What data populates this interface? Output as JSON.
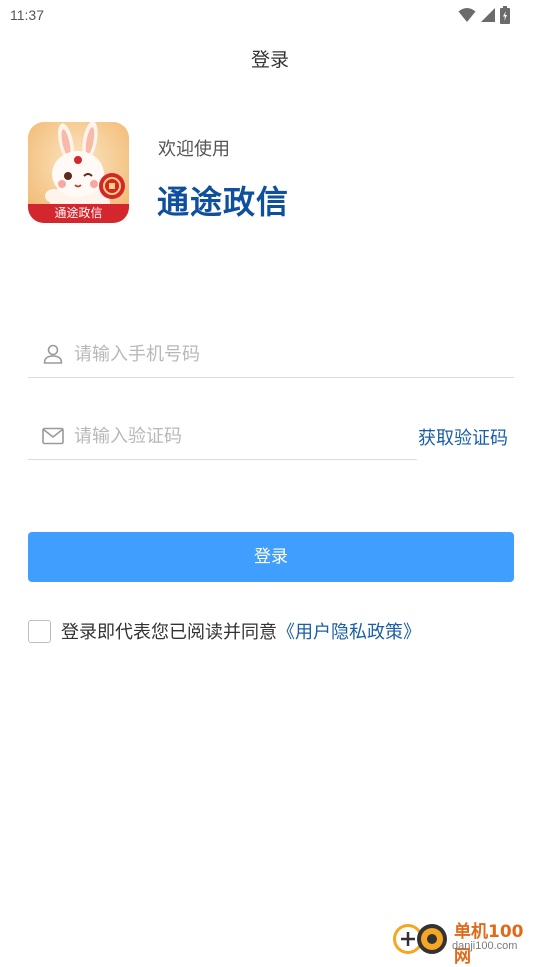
{
  "status_bar": {
    "time": "11:37",
    "icons": [
      "wifi-icon",
      "signal-icon",
      "battery-icon"
    ]
  },
  "header": {
    "title": "登录"
  },
  "brand": {
    "logo_text": "通途政信",
    "welcome": "欢迎使用",
    "app_name": "通途政信",
    "app_name_color": "#0e4f9e"
  },
  "form": {
    "phone": {
      "icon": "user-icon",
      "value": "",
      "placeholder": "请输入手机号码"
    },
    "code": {
      "icon": "mail-icon",
      "value": "",
      "placeholder": "请输入验证码"
    },
    "get_code_label": "获取验证码",
    "login_label": "登录",
    "login_color": "#409eff"
  },
  "agreement": {
    "checked": false,
    "text": "登录即代表您已阅读并同意",
    "link": "《用户隐私政策》"
  },
  "watermark": {
    "line1": "单机100网",
    "line2": "danji100.com"
  }
}
